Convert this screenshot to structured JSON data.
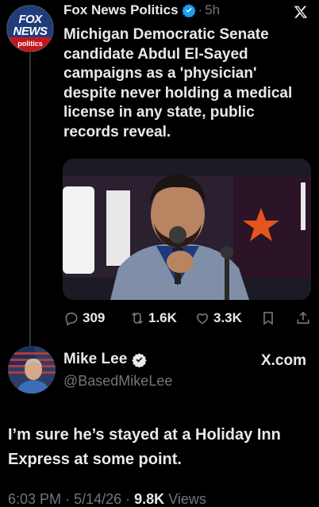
{
  "quoted_tweet": {
    "account_name": "Fox News Politics",
    "separator": "·",
    "time": "5h",
    "avatar": {
      "logo_top": "FOX NEWS",
      "logo_bottom": "politics"
    },
    "text": "Michigan Democratic Senate candidate Abdul El-Sayed campaigns as a 'physician' despite never holding a medical license in any state, public records reveal.",
    "stats": {
      "replies": "309",
      "reposts": "1.6K",
      "likes": "3.3K"
    }
  },
  "tweet": {
    "display_name": "Mike Lee",
    "handle": "@BasedMikeLee",
    "badge": "X.com",
    "text": "I’m sure he’s stayed at a Holiday Inn Express at some point.",
    "time": "6:03 PM",
    "date": "5/14/26",
    "views": "9.8K",
    "views_label": "Views"
  },
  "colors": {
    "background": "#000000",
    "text": "#e7e9ea",
    "secondary": "#71767b",
    "verified": "#1d9bf0"
  }
}
